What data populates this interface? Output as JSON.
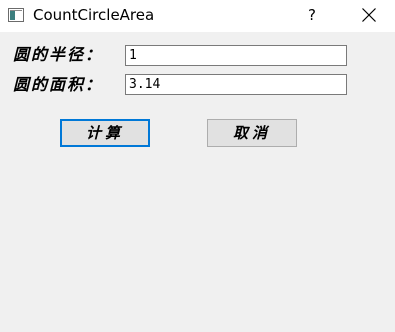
{
  "window": {
    "title": "CountCircleArea",
    "help_label": "?",
    "close_icon": "close-icon",
    "app_icon": "window-app-icon"
  },
  "form": {
    "radius_label": "圆的半径：",
    "radius_value": "1",
    "area_label": "圆的面积：",
    "area_value": "3.14"
  },
  "buttons": {
    "calculate_label": "计算",
    "cancel_label": "取消"
  },
  "colors": {
    "focus_border": "#0078d7",
    "dialog_background": "#f0f0f0"
  }
}
